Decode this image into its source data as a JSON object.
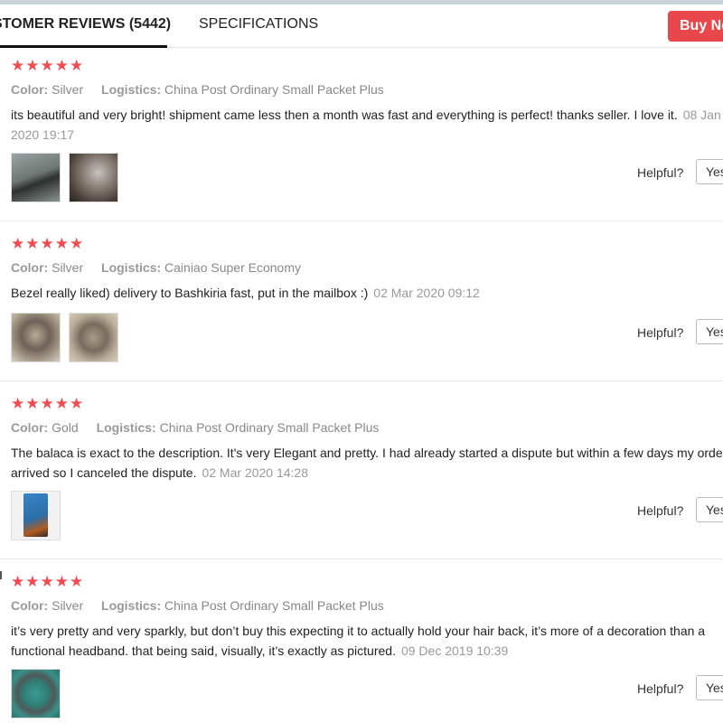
{
  "tabs": {
    "reviews_label": "STOMER REVIEWS (5442)",
    "specs_label": "SPECIFICATIONS",
    "buy_now": "Buy No"
  },
  "labels": {
    "color": "Color:",
    "logistics": "Logistics:",
    "helpful": "Helpful?",
    "yes": "Yes"
  },
  "reviews": [
    {
      "stars": "★★★★★",
      "color": "Silver",
      "logistics": "China Post Ordinary Small Packet Plus",
      "text": "its beautiful and very bright! shipment came less then a month was fast and everything is perfect! thanks seller. I love it.",
      "date": "08 Jan 2020 19:17"
    },
    {
      "stars": "★★★★★",
      "color": "Silver",
      "logistics": "Cainiao Super Economy",
      "text": "Bezel really liked) delivery to Bashkiria fast, put in the mailbox :)",
      "date": "02 Mar 2020 09:12"
    },
    {
      "stars": "★★★★★",
      "color": "Gold",
      "logistics": "China Post Ordinary Small Packet Plus",
      "text": "The balaca is exact to the description. It's very Elegant and pretty. I had already started a dispute but within a few days my order arrived so I canceled the dispute.",
      "date": "02 Mar 2020 14:28"
    },
    {
      "stars": "★★★★★",
      "color": "Silver",
      "logistics": "China Post Ordinary Small Packet Plus",
      "text": "it’s very pretty and very sparkly, but don’t buy this expecting it to actually hold your hair back, it’s more of a decoration than a functional headband. that being said, visually, it’s exactly as pictured.",
      "date": "09 Dec 2019 10:39"
    }
  ]
}
